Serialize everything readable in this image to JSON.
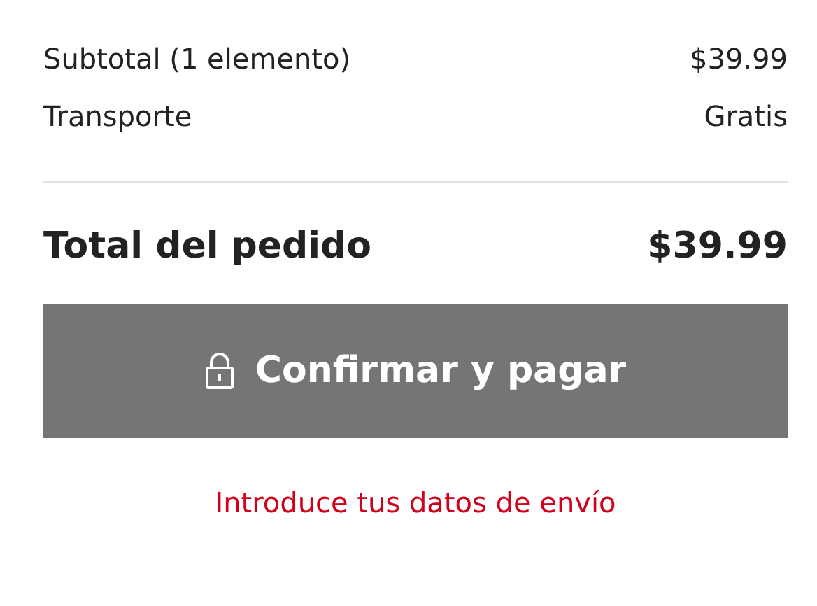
{
  "summary": [
    {
      "label": "Subtotal (1 elemento)",
      "value": "$39.99"
    },
    {
      "label": "Transporte",
      "value": "Gratis"
    }
  ],
  "total": {
    "label": "Total del pedido",
    "value": "$39.99"
  },
  "confirm_button": {
    "label": "Confirmar y pagar",
    "disabled": true
  },
  "error_message": "Introduce tus datos de envío"
}
